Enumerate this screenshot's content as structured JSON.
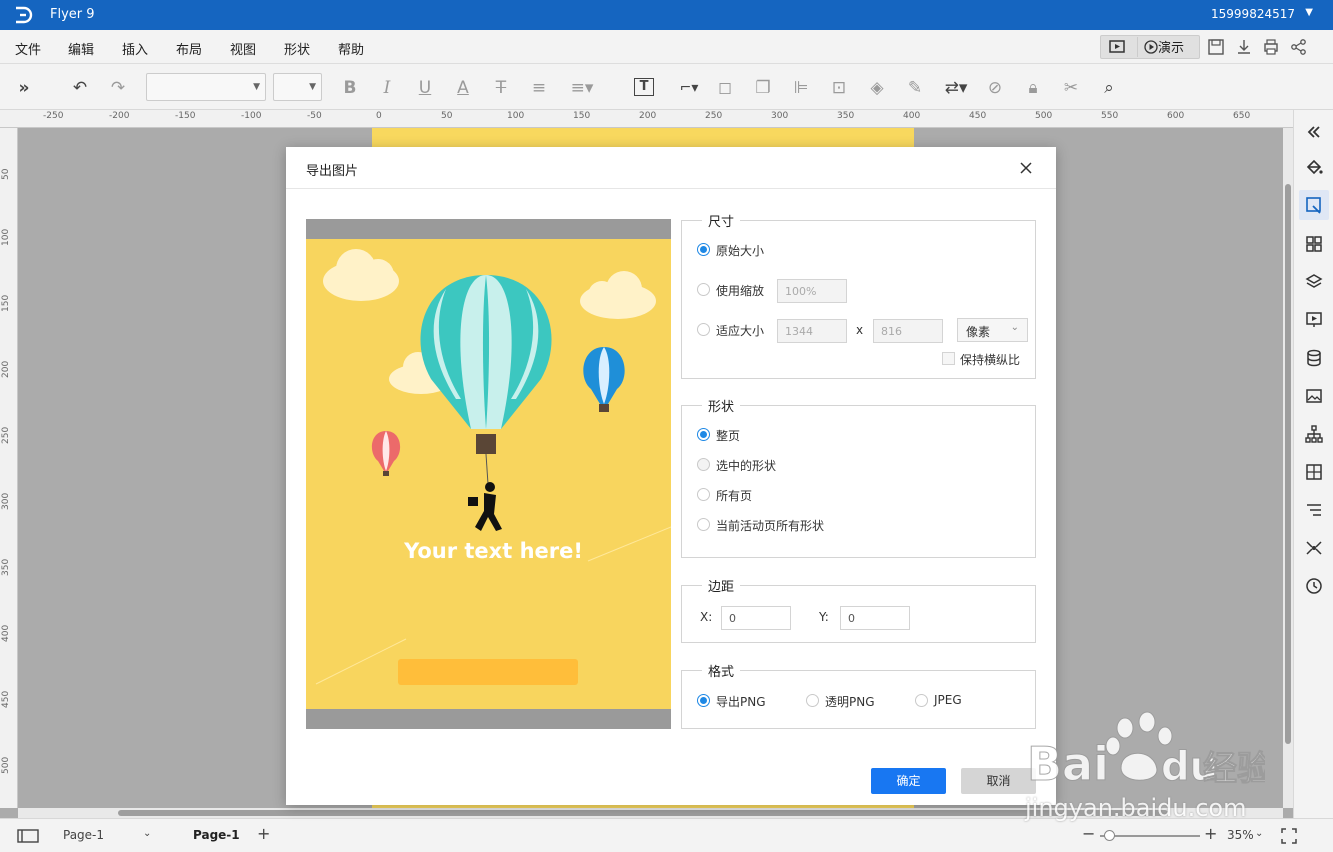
{
  "app": {
    "title": "Flyer 9",
    "user": "15999824517"
  },
  "menu": [
    "文件",
    "编辑",
    "插入",
    "布局",
    "视图",
    "形状",
    "帮助"
  ],
  "menu_right": {
    "present": "演示"
  },
  "ruler": {
    "top": [
      "-250",
      "-200",
      "-150",
      "-100",
      "-50",
      "0",
      "50",
      "100",
      "150",
      "200",
      "250",
      "300",
      "350",
      "400",
      "450",
      "500",
      "550",
      "600",
      "650"
    ],
    "left": [
      "50",
      "100",
      "150",
      "200",
      "250",
      "300",
      "350",
      "400",
      "450",
      "500"
    ]
  },
  "status": {
    "page_select": "Page-1",
    "page_tab": "Page-1",
    "zoom": "35%"
  },
  "dialog": {
    "title": "导出图片",
    "preview_text": "Your text here!",
    "size": {
      "legend": "尺寸",
      "original": "原始大小",
      "scale": "使用缩放",
      "scale_value": "100%",
      "fit": "适应大小",
      "width": "1344",
      "times": "x",
      "height": "816",
      "unit": "像素",
      "keep_ratio": "保持横纵比"
    },
    "shape": {
      "legend": "形状",
      "whole": "整页",
      "selected": "选中的形状",
      "all_pages": "所有页",
      "current_all": "当前活动页所有形状"
    },
    "margin": {
      "legend": "边距",
      "x_label": "X:",
      "x_value": "0",
      "y_label": "Y:",
      "y_value": "0"
    },
    "format": {
      "legend": "格式",
      "png": "导出PNG",
      "transparent": "透明PNG",
      "jpeg": "JPEG"
    },
    "ok": "确定",
    "cancel": "取消"
  },
  "watermark": {
    "site": "jingyan.baidu.com"
  },
  "colors": {
    "titlebar": "#1565c0",
    "primary": "#1877f2",
    "poster": "#f8d55e"
  }
}
